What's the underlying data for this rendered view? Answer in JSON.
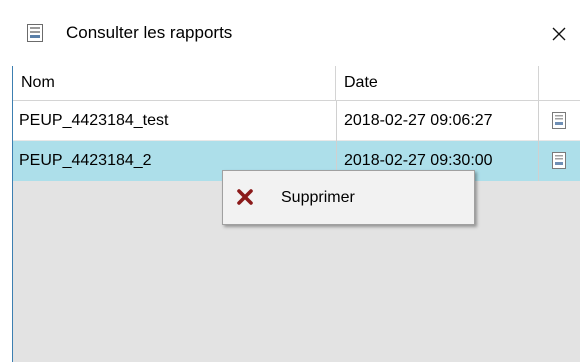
{
  "window": {
    "title": "Consulter les rapports",
    "title_icon": "document-window-icon",
    "close_label": "×"
  },
  "table": {
    "columns": [
      "Nom",
      "Date",
      ""
    ],
    "rows": [
      {
        "nom": "PEUP_4423184_test",
        "date": "2018-02-27 09:06:27",
        "icon": "report-file-icon",
        "selected": false
      },
      {
        "nom": "PEUP_4423184_2",
        "date": "2018-02-27 09:30:00",
        "icon": "report-file-icon",
        "selected": true
      }
    ]
  },
  "context_menu": {
    "items": [
      {
        "label": "Supprimer",
        "icon": "delete-x-icon"
      }
    ]
  },
  "colors": {
    "selection": "#addfea",
    "delete_icon": "#8b1a1a",
    "border_accent": "#3c7fb1",
    "empty_area": "#e3e3e3"
  }
}
